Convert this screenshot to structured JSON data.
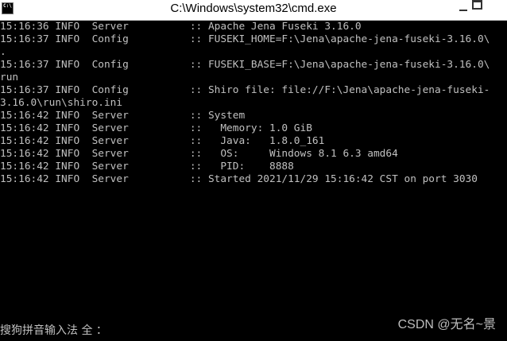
{
  "window": {
    "title": "C:\\Windows\\system32\\cmd.exe",
    "icon_label": "C:\\",
    "icon": "cmd-icon",
    "minimize_icon": "minimize-icon",
    "maximize_icon": "maximize-icon"
  },
  "console": {
    "lines": [
      "15:16:36 INFO  Server          :: Apache Jena Fuseki 3.16.0",
      "15:16:37 INFO  Config          :: FUSEKI_HOME=F:\\Jena\\apache-jena-fuseki-3.16.0\\",
      ".",
      "15:16:37 INFO  Config          :: FUSEKI_BASE=F:\\Jena\\apache-jena-fuseki-3.16.0\\",
      "run",
      "15:16:37 INFO  Config          :: Shiro file: file://F:\\Jena\\apache-jena-fuseki-",
      "3.16.0\\run\\shiro.ini",
      "15:16:42 INFO  Server          :: System",
      "15:16:42 INFO  Server          ::   Memory: 1.0 GiB",
      "15:16:42 INFO  Server          ::   Java:   1.8.0_161",
      "15:16:42 INFO  Server          ::   OS:     Windows 8.1 6.3 amd64",
      "15:16:42 INFO  Server          ::   PID:    8888",
      "15:16:42 INFO  Server          :: Started 2021/11/29 15:16:42 CST on port 3030"
    ]
  },
  "ime": {
    "status": "搜狗拼音输入法 全 ："
  },
  "watermark": {
    "text": "CSDN @无名~景"
  },
  "colors": {
    "console_bg": "#000000",
    "console_text": "#c0c0c0",
    "titlebar_bg": "#ffffff"
  }
}
